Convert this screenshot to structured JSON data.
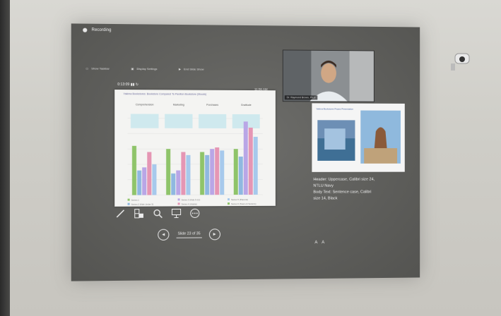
{
  "app": {
    "recording_label": "Recording"
  },
  "toolbar": {
    "items": [
      "Show Taskbar",
      "Display Settings",
      "End Slide Show"
    ]
  },
  "timers": {
    "elapsed": "0:13:09",
    "clock": "11:06 AM"
  },
  "current_slide": {
    "title": "Yakima Bookstores: Bookstore Compared To Pavilion Bookstore (Moods)",
    "series_labels": [
      "Comprehension",
      "Marketing",
      "Purchases",
      "Gratitude"
    ],
    "legend": [
      "Series 1",
      "Series 2 (Kids Under 5)",
      "Series 3 (Kids 5-12)",
      "Series 4 (Adults)",
      "Series 5 (Parents)",
      "Series 6 (Teens & Seniors)"
    ]
  },
  "chart_data": {
    "type": "bar",
    "categories": [
      "Comprehension",
      "Marketing",
      "Purchases",
      "Gratitude"
    ],
    "series": [
      {
        "name": "Series 1",
        "values": [
          3.2,
          3.0,
          2.8,
          3.0
        ]
      },
      {
        "name": "Series 2",
        "values": [
          1.6,
          1.4,
          2.6,
          2.5
        ]
      },
      {
        "name": "Series 3",
        "values": [
          1.8,
          1.6,
          3.0,
          4.8
        ]
      },
      {
        "name": "Series 4",
        "values": [
          2.8,
          2.8,
          3.1,
          4.4
        ]
      },
      {
        "name": "Series 5",
        "values": [
          2.0,
          2.6,
          2.9,
          3.8
        ]
      }
    ],
    "colors": [
      "#8fc46a",
      "#8fb8e0",
      "#b9a6e6",
      "#e596b4",
      "#a7c9ec"
    ],
    "ylim": [
      0,
      5
    ],
    "grid": true,
    "legend_position": "bottom"
  },
  "camera": {
    "name_label": "Dr. Raymond Brown, Ph.D"
  },
  "next_slide": {
    "title": "Yakima Bookstores Project Presentation"
  },
  "notes": {
    "lines": [
      "Header: Uppercase, Calibri size 24,",
      "NTLU Navy",
      "Body Text: Sentence case, Calibri",
      "size 14, Black"
    ]
  },
  "navigation": {
    "slide_counter": "Slide 23 of 35"
  },
  "font_size_controls": [
    "A",
    "A"
  ],
  "icons": {
    "tools": [
      "pen-icon",
      "slide-grid-icon",
      "zoom-icon",
      "pointer-icon",
      "more-icon"
    ]
  }
}
